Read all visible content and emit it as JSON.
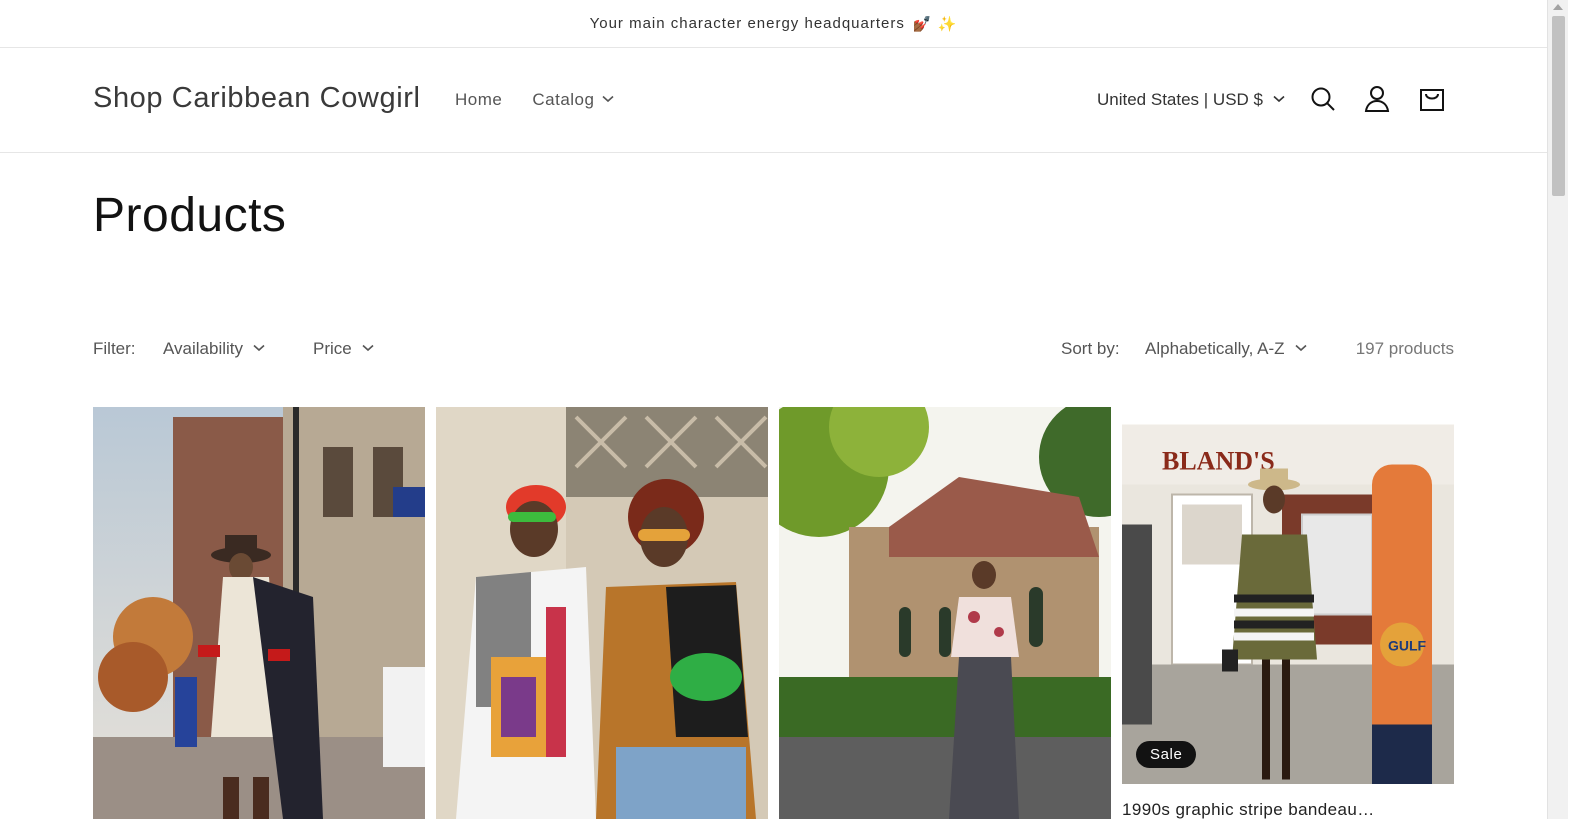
{
  "announcement": {
    "text": "Your main character energy headquarters",
    "emoji": "💅🏾 ✨"
  },
  "header": {
    "logo": "Shop Caribbean Cowgirl",
    "nav": [
      {
        "label": "Home"
      },
      {
        "label": "Catalog"
      }
    ],
    "country": "United States | USD $",
    "icons": [
      "search-icon",
      "account-icon",
      "cart-icon"
    ]
  },
  "page": {
    "title": "Products"
  },
  "filters": {
    "label": "Filter:",
    "availability": "Availability",
    "price": "Price",
    "sort_label": "Sort by:",
    "sort_value": "Alphabetically, A-Z",
    "count": "197 products"
  },
  "products": [
    {
      "badge": ""
    },
    {
      "badge": ""
    },
    {
      "badge": ""
    },
    {
      "badge": "Sale",
      "title_peek": "1990s graphic stripe bandeau…"
    }
  ],
  "colors": {
    "text": "#121212",
    "muted": "#555555",
    "badge_bg": "#121212",
    "divider": "#e6e6e6"
  }
}
